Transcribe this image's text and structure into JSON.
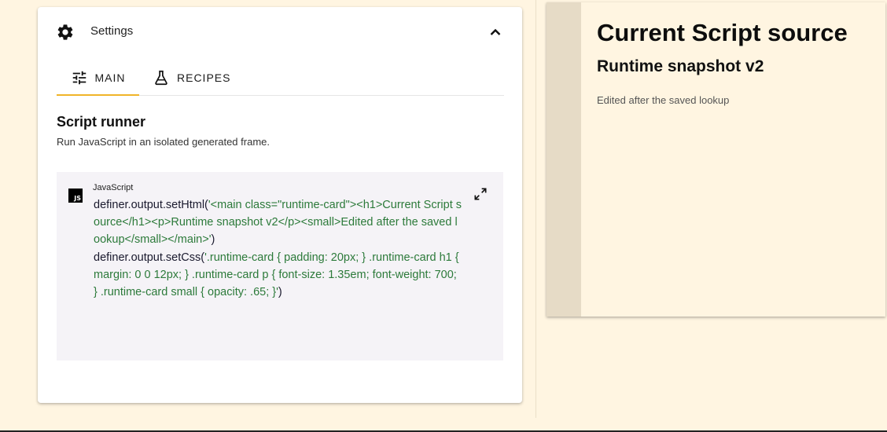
{
  "settings": {
    "title": "Settings",
    "icon": "gear-icon",
    "collapse_icon": "chevron-up-icon"
  },
  "tabs": [
    {
      "label": "MAIN",
      "icon": "tune-sliders-icon",
      "active": true
    },
    {
      "label": "RECIPES",
      "icon": "flask-icon",
      "active": false
    }
  ],
  "colors": {
    "accent": "#f0b429",
    "page_background": "#fff5e1",
    "code_string": "#2c7a3a",
    "preview_gutter": "#e6dbc6"
  },
  "script_runner": {
    "title": "Script runner",
    "description": "Run JavaScript in an isolated generated frame.",
    "language": "JavaScript",
    "language_icon": "js-icon",
    "expand_icon": "expand-icon",
    "code_line1_ident": "definer.output.setHtml(",
    "code_line1_string": "'<main class=\"runtime-card\"><h1>Current Script source</h1><p>Runtime snapshot v2</p><small>Edited after the saved lookup</small></main>'",
    "code_line1_close": ")",
    "code_line2_ident": "definer.output.setCss(",
    "code_line2_string": "'.runtime-card { padding: 20px; } .runtime-card h1 { margin: 0 0 12px; } .runtime-card p { font-size: 1.35em; font-weight: 700; } .runtime-card small { opacity: .65; }'",
    "code_line2_close": ")"
  },
  "preview": {
    "heading": "Current Script source",
    "subheading": "Runtime snapshot v2",
    "note": "Edited after the saved lookup"
  }
}
